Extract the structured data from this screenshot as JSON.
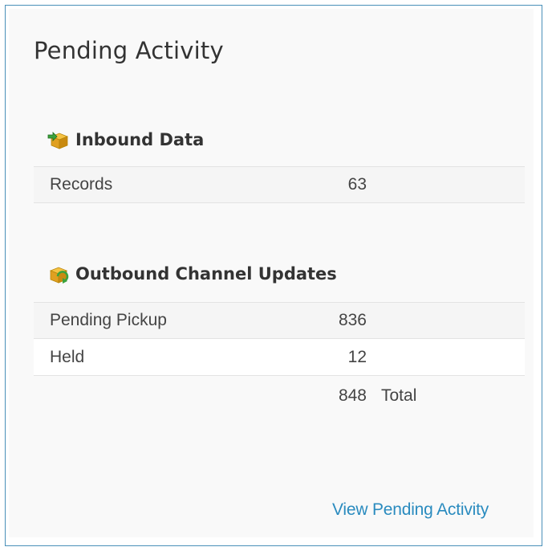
{
  "panel": {
    "title": "Pending Activity"
  },
  "inbound": {
    "header": "Inbound Data",
    "icon": "box-arrow-in-icon",
    "rows": [
      {
        "label": "Records",
        "value": "63"
      }
    ]
  },
  "outbound": {
    "header": "Outbound Channel Updates",
    "icon": "box-sync-icon",
    "rows": [
      {
        "label": "Pending Pickup",
        "value": "836"
      },
      {
        "label": "Held",
        "value": "12"
      }
    ],
    "total_value": "848",
    "total_label": "Total"
  },
  "footer": {
    "link_label": "View Pending Activity"
  },
  "colors": {
    "border": "#4a90b8",
    "link": "#2a8bbf",
    "row_shade": "#f5f5f5"
  }
}
